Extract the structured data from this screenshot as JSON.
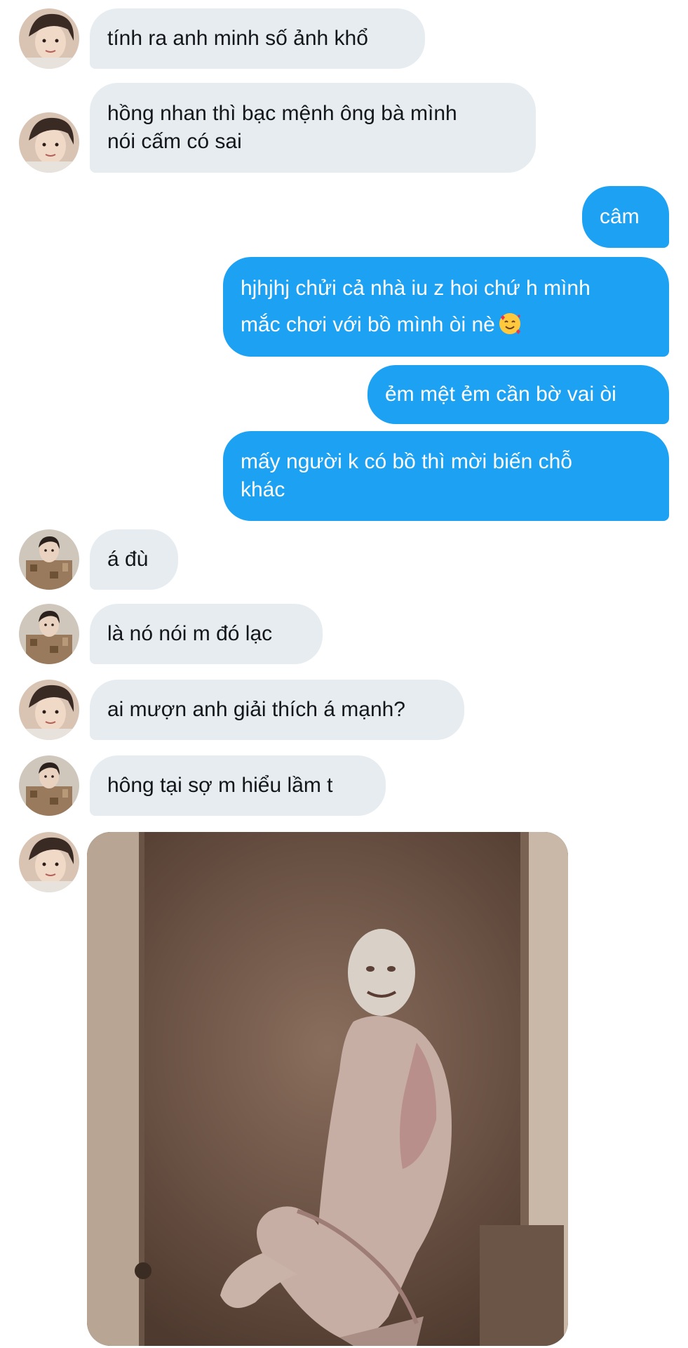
{
  "avatars": {
    "girl": "girl-avatar",
    "boy": "boy-avatar"
  },
  "colors": {
    "incoming_bubble": "#e6ecf0",
    "outgoing_bubble": "#1da1f2",
    "incoming_text": "#14171a",
    "outgoing_text": "#ffffff"
  },
  "messages": [
    {
      "sender": "girl",
      "lines": [
        "tính ra anh minh số ảnh khổ"
      ]
    },
    {
      "sender": "girl",
      "lines": [
        "hồng nhan thì bạc mệnh ông bà mình",
        "nói cấm có sai"
      ]
    },
    {
      "sender": "me",
      "lines": [
        "câm"
      ]
    },
    {
      "sender": "me",
      "lines": [
        "hjhjhj chửi cả nhà iu z hoi chứ h mình",
        "mắc chơi với bồ mình òi nè"
      ],
      "emoji": "smiling-face-with-hearts-icon"
    },
    {
      "sender": "me",
      "lines": [
        "ẻm mệt ẻm cần bờ vai òi"
      ]
    },
    {
      "sender": "me",
      "lines": [
        "mấy người k có bồ thì mời biến chỗ",
        "khác"
      ]
    },
    {
      "sender": "boy",
      "lines": [
        "á đù"
      ]
    },
    {
      "sender": "boy",
      "lines": [
        "là nó nói m đó lạc"
      ]
    },
    {
      "sender": "girl",
      "lines": [
        "ai mượn anh giải thích á mạnh?"
      ]
    },
    {
      "sender": "boy",
      "lines": [
        "hông tại sợ m hiểu lầm t"
      ]
    },
    {
      "sender": "girl",
      "media": "meme-photo"
    }
  ]
}
